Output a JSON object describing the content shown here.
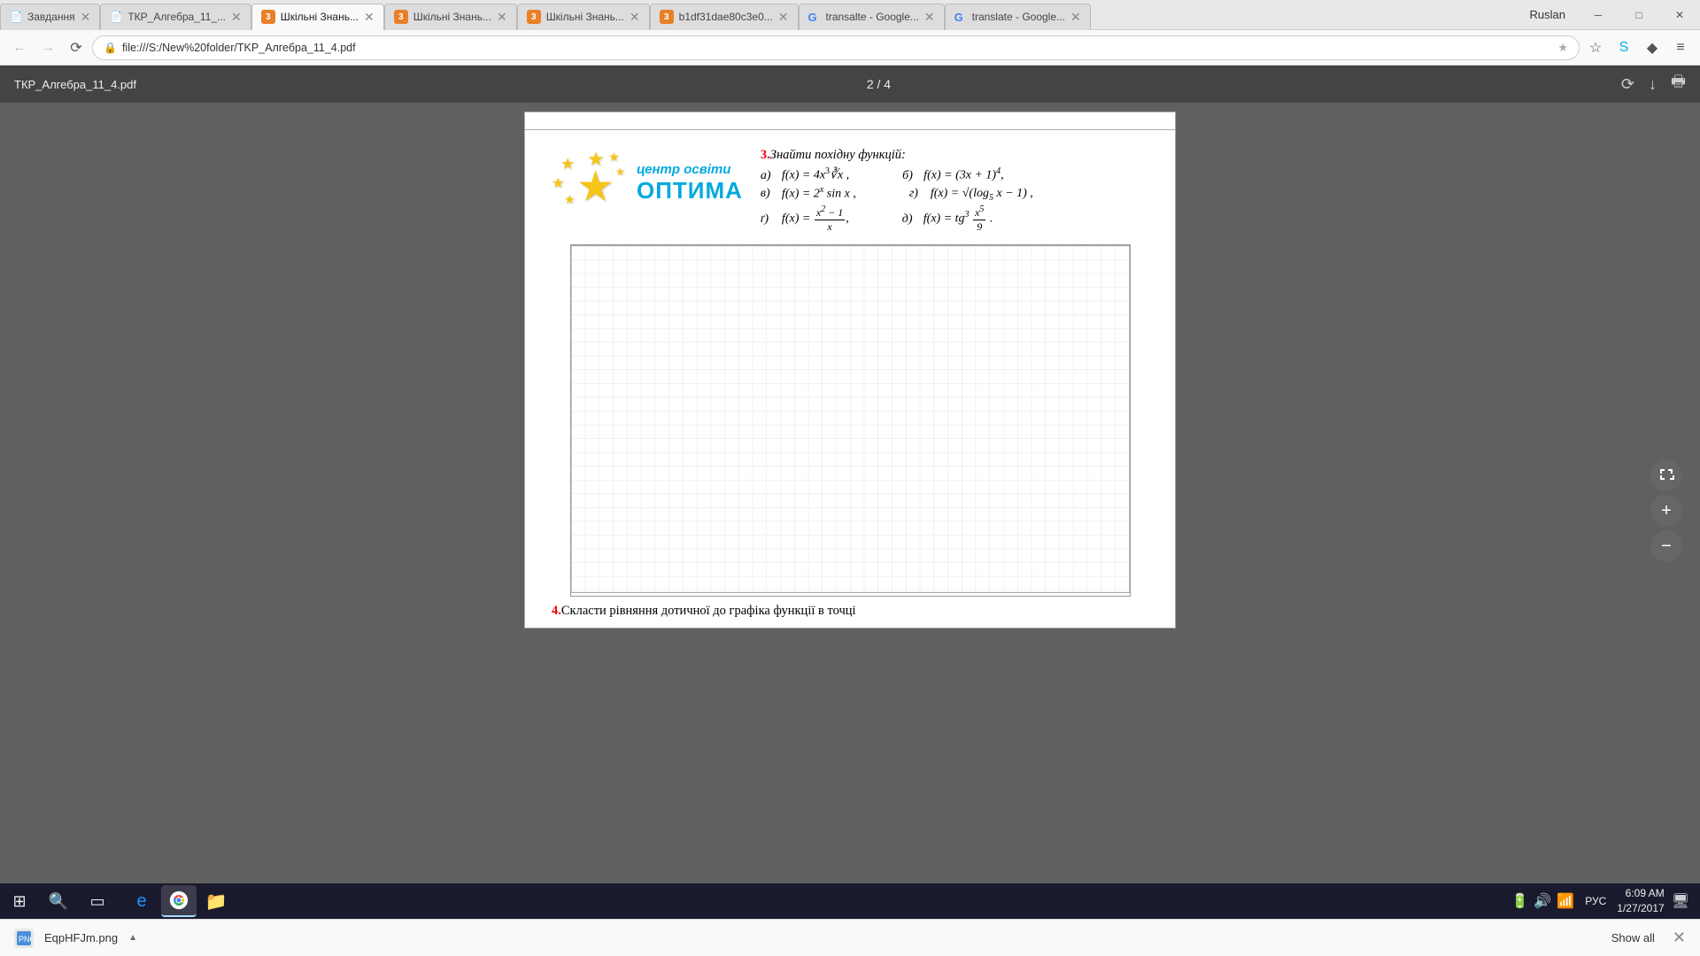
{
  "browser": {
    "tabs": [
      {
        "id": "tab1",
        "label": "Завдання",
        "favicon": "📄",
        "active": false
      },
      {
        "id": "tab2",
        "label": "ТКР_Алгебра_11_...",
        "favicon": "📄",
        "active": false
      },
      {
        "id": "tab3",
        "label": "Шкільні Знань...",
        "favicon": "3",
        "active": true
      },
      {
        "id": "tab4",
        "label": "Шкільні Знань...",
        "favicon": "3",
        "active": false
      },
      {
        "id": "tab5",
        "label": "Шкільні Знань...",
        "favicon": "3",
        "active": false
      },
      {
        "id": "tab6",
        "label": "b1df31dae80c3e0...",
        "favicon": "3",
        "active": false
      },
      {
        "id": "tab7",
        "label": "transalte - Google...",
        "favicon": "G",
        "active": false
      },
      {
        "id": "tab8",
        "label": "translate - Google...",
        "favicon": "G",
        "active": false
      }
    ],
    "address": "file:///S:/New%20folder/TKP_Алгебра_11_4.pdf",
    "user": "Ruslan",
    "window_controls": [
      "─",
      "□",
      "✕"
    ]
  },
  "pdf": {
    "title": "ТКР_Алгебра_11_4.pdf",
    "page_current": "2",
    "page_total": "4",
    "page_display": "2 / 4"
  },
  "problem3": {
    "number": "3.",
    "instruction": "Знайти похідну функцій:",
    "items": [
      {
        "label": "а)",
        "expr": "f(x) = 4x∛x ,"
      },
      {
        "label": "б)",
        "expr": "f(x) = (3x + 1)⁴,"
      },
      {
        "label": "в)",
        "expr": "f(x) = 2ˣ sin x ,"
      },
      {
        "label": "г)",
        "expr": "f(x) = √(log₅ x − 1) ,"
      },
      {
        "label": "ґ)",
        "expr": "f(x) = (x² − 1)/x ,"
      },
      {
        "label": "д)",
        "expr": "f(x) = tg³(x⁵/9) ."
      }
    ]
  },
  "problem4": {
    "number": "4.",
    "text": "Скласти рівняння дотичної до графіка функції в точці"
  },
  "download_bar": {
    "filename": "EqpHFJm.png",
    "show_all": "Show all"
  },
  "taskbar": {
    "time": "6:09 AM",
    "date": "1/27/2017",
    "language": "РУС",
    "apps": [
      "⊞",
      "🔍",
      "▭",
      "🌐",
      "📁",
      "🌐"
    ]
  }
}
